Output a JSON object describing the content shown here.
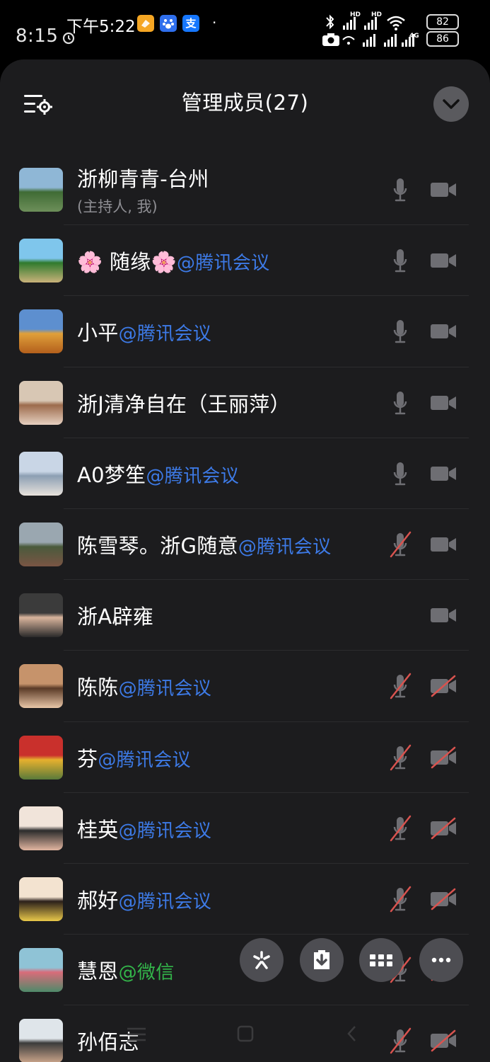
{
  "status_bar": {
    "time_back": "8:15",
    "time_front": "下午5:22",
    "app_icons": [
      {
        "name": "orange-app-icon",
        "color": "#f5a623",
        "glyph": ""
      },
      {
        "name": "baidu-app-icon",
        "color": "#2f6fed",
        "glyph": ""
      },
      {
        "name": "alipay-app-icon",
        "color": "#1677ff",
        "glyph": "支"
      }
    ],
    "dot": "·",
    "network_labels": [
      "HD",
      "HD",
      "4G"
    ],
    "battery_front": "82",
    "battery_back": "86"
  },
  "header": {
    "title": "管理成员(27)"
  },
  "members": [
    {
      "name": "浙柳青青-台州",
      "tag": "",
      "tag_type": "",
      "sub": "(主持人, 我)",
      "mic": "on",
      "cam": "on",
      "avatar_colors": [
        "#8fb7d6",
        "#3f6b34",
        "#6d8f5a"
      ]
    },
    {
      "name": "🌸 随缘🌸",
      "tag": "@腾讯会议",
      "tag_type": "tencent",
      "sub": "",
      "mic": "on",
      "cam": "on",
      "avatar_colors": [
        "#7fc6ec",
        "#2f7a2d",
        "#c9b27a"
      ]
    },
    {
      "name": "小平",
      "tag": "@腾讯会议",
      "tag_type": "tencent",
      "sub": "",
      "mic": "on",
      "cam": "on",
      "avatar_colors": [
        "#5d8fcf",
        "#e0a03a",
        "#b35f1c"
      ]
    },
    {
      "name": "浙J清净自在（王丽萍）",
      "tag": "",
      "tag_type": "",
      "sub": "",
      "mic": "on",
      "cam": "on",
      "avatar_colors": [
        "#d8c7b4",
        "#9c6b4c",
        "#e6d0c0"
      ]
    },
    {
      "name": "A0梦笙",
      "tag": "@腾讯会议",
      "tag_type": "tencent",
      "sub": "",
      "mic": "on",
      "cam": "on",
      "avatar_colors": [
        "#c9d6e6",
        "#8c9fb3",
        "#e8e2dc"
      ]
    },
    {
      "name": "陈雪琴。浙G随意",
      "tag": "@腾讯会议",
      "tag_type": "tencent",
      "sub": "",
      "mic": "off",
      "cam": "on",
      "avatar_colors": [
        "#9aa7b0",
        "#4a5a3c",
        "#7a5544"
      ]
    },
    {
      "name": "浙A辟雍",
      "tag": "",
      "tag_type": "",
      "sub": "",
      "mic": "none",
      "cam": "on",
      "avatar_colors": [
        "#3b3b3b",
        "#d9b59d",
        "#2a2a2a"
      ]
    },
    {
      "name": "陈陈",
      "tag": "@腾讯会议",
      "tag_type": "tencent",
      "sub": "",
      "mic": "off",
      "cam": "off",
      "avatar_colors": [
        "#c6936b",
        "#5a3a26",
        "#e8c6a7"
      ]
    },
    {
      "name": "芬",
      "tag": "@腾讯会议",
      "tag_type": "tencent",
      "sub": "",
      "mic": "off",
      "cam": "off",
      "avatar_colors": [
        "#c9302c",
        "#e6b02e",
        "#5a7a3a"
      ]
    },
    {
      "name": "桂英",
      "tag": "@腾讯会议",
      "tag_type": "tencent",
      "sub": "",
      "mic": "off",
      "cam": "off",
      "avatar_colors": [
        "#f1e4da",
        "#2b2b2b",
        "#e2b5a0"
      ]
    },
    {
      "name": "郝好",
      "tag": "@腾讯会议",
      "tag_type": "tencent",
      "sub": "",
      "mic": "off",
      "cam": "off",
      "avatar_colors": [
        "#f3e3d0",
        "#2b1f1a",
        "#e9c84a"
      ]
    },
    {
      "name": "慧恩",
      "tag": "@微信",
      "tag_type": "wechat",
      "sub": "",
      "mic": "off",
      "cam": "off",
      "avatar_colors": [
        "#8fc3d6",
        "#d96c7a",
        "#4f8a6a"
      ]
    },
    {
      "name": "孙佰志",
      "tag": "",
      "tag_type": "",
      "sub": "",
      "mic": "off",
      "cam": "off",
      "avatar_colors": [
        "#dfe5ea",
        "#3b3b3b",
        "#c9a48a"
      ]
    }
  ],
  "toolbar": [
    {
      "name": "invite-button",
      "icon": "sparkle-icon"
    },
    {
      "name": "save-button",
      "icon": "download-icon"
    },
    {
      "name": "grid-button",
      "icon": "grid-icon"
    },
    {
      "name": "more-button",
      "icon": "more-icon"
    }
  ],
  "colors": {
    "panel_bg": "#1c1c1e",
    "tencent_tag": "#3d7ae6",
    "wechat_tag": "#33b54a",
    "muted_red": "#d9534f"
  }
}
